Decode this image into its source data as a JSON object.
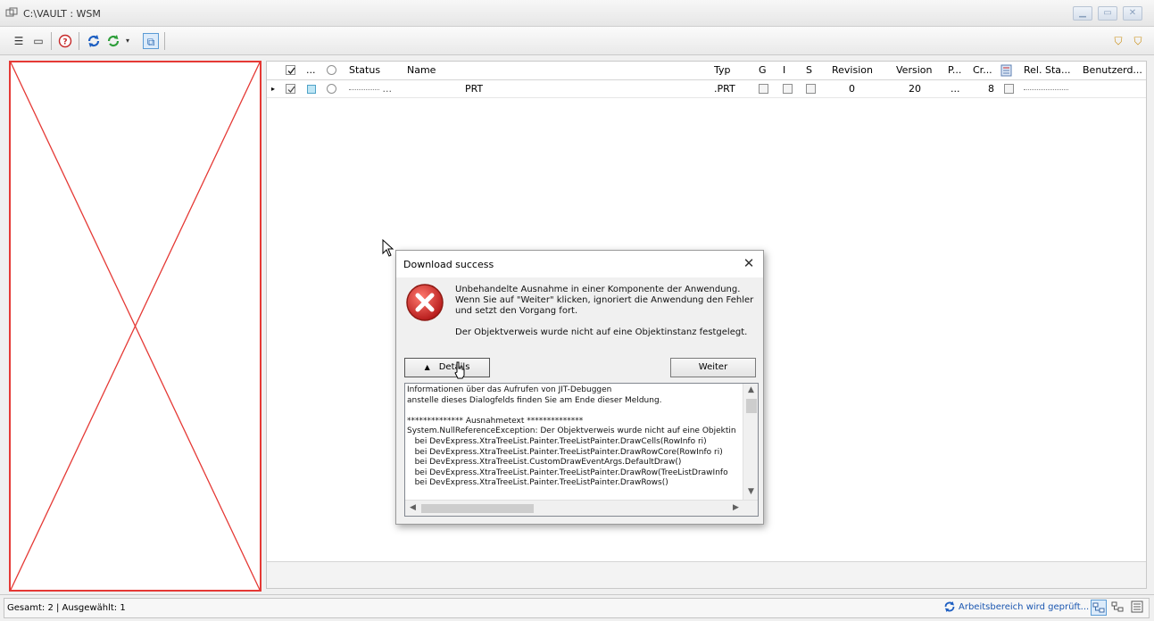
{
  "window": {
    "title": "C:\\VAULT : WSM"
  },
  "grid": {
    "columns": [
      "...",
      "Status",
      "Name",
      "Typ",
      "G",
      "I",
      "S",
      "Revision",
      "Version",
      "P...",
      "Cr...",
      "Rel. Sta...",
      "Benutzerd..."
    ],
    "row": {
      "status": "...",
      "name": "PRT",
      "typ": ".PRT",
      "revision": "0",
      "version": "20",
      "p": "...",
      "cr": "8"
    }
  },
  "statusbar": {
    "summary": "Gesamt: 2 | Ausgewählt: 1",
    "message": "Arbeitsbereich wird geprüft..."
  },
  "dialog": {
    "title": "Download success",
    "message_lines": [
      "Unbehandelte Ausnahme in einer Komponente der Anwendung.",
      "Wenn Sie auf \"Weiter\" klicken, ignoriert die Anwendung den Fehler",
      "und setzt den Vorgang fort."
    ],
    "message2": "Der Objektverweis wurde nicht auf eine Objektinstanz festgelegt.",
    "details_label": "Details",
    "continue_label": "Weiter",
    "details_lines": [
      "Informationen über das Aufrufen von JIT-Debuggen",
      "anstelle dieses Dialogfelds finden Sie am Ende dieser Meldung.",
      "",
      "************** Ausnahmetext **************",
      "System.NullReferenceException: Der Objektverweis wurde nicht auf eine Objektin",
      "   bei DevExpress.XtraTreeList.Painter.TreeListPainter.DrawCells(RowInfo ri)",
      "   bei DevExpress.XtraTreeList.Painter.TreeListPainter.DrawRowCore(RowInfo ri)",
      "   bei DevExpress.XtraTreeList.CustomDrawEventArgs.DefaultDraw()",
      "   bei DevExpress.XtraTreeList.Painter.TreeListPainter.DrawRow(TreeListDrawInfo",
      "   bei DevExpress.XtraTreeList.Painter.TreeListPainter.DrawRows()"
    ]
  },
  "colors": {
    "preview_border": "#e53935",
    "error_icon": "#d9302b",
    "status_link": "#1a56b0"
  }
}
